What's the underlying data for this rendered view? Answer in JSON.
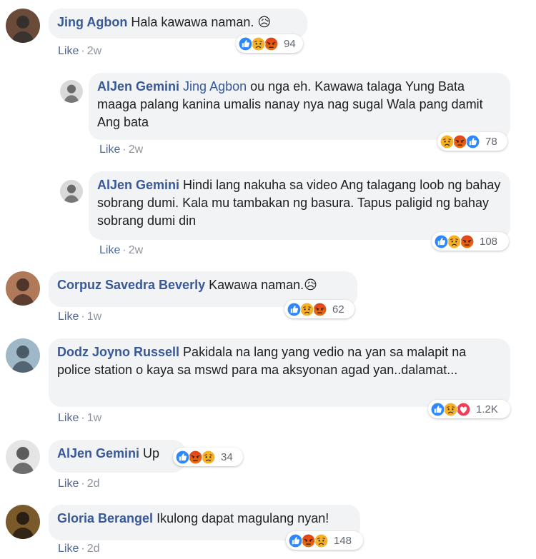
{
  "comments": [
    {
      "author": "Jing Agbon",
      "mention": "",
      "text": "Hala kawawa naman. 😥",
      "like": "Like",
      "time": "2w",
      "reactions": [
        "like-icon",
        "sad-icon",
        "angry-icon"
      ],
      "count": "94",
      "avatar_colors": [
        "#6a4b3a",
        "#2b2b2b"
      ]
    },
    {
      "author": "AlJen Gemini",
      "mention": "Jing Agbon",
      "text": "ou nga eh. Kawawa talaga Yung Bata maaga palang kanina umalis nanay nya nag sugal Wala pang damit Ang bata",
      "like": "Like",
      "time": "2w",
      "reactions": [
        "sad-icon",
        "angry-icon",
        "like-icon"
      ],
      "count": "78",
      "avatar_colors": [
        "#d9d9d9",
        "#555555"
      ]
    },
    {
      "author": "AlJen Gemini",
      "mention": "",
      "text": "Hindi lang nakuha sa video Ang talagang loob ng bahay sobrang dumi. Kala mu tambakan ng basura. Tapus paligid ng bahay sobrang dumi din",
      "like": "Like",
      "time": "2w",
      "reactions": [
        "like-icon",
        "sad-icon",
        "angry-icon"
      ],
      "count": "108",
      "avatar_colors": [
        "#d9d9d9",
        "#555555"
      ]
    },
    {
      "author": "Corpuz Savedra Beverly",
      "mention": "",
      "text": "Kawawa naman.😥",
      "like": "Like",
      "time": "1w",
      "reactions": [
        "like-icon",
        "sad-icon",
        "angry-icon"
      ],
      "count": "62",
      "avatar_colors": [
        "#b07a5a",
        "#3d2a22"
      ]
    },
    {
      "author": "Dodz Joyno Russell",
      "mention": "",
      "text": "Pakidala na lang yang vedio na yan sa malapit na police station o kaya sa mswd para ma aksyonan agad yan..dalamat...",
      "like": "Like",
      "time": "1w",
      "reactions": [
        "like-icon",
        "sad-icon",
        "love-icon"
      ],
      "count": "1.2K",
      "avatar_colors": [
        "#9fb8c8",
        "#3a4a55"
      ]
    },
    {
      "author": "AlJen Gemini",
      "mention": "",
      "text": "Up",
      "like": "Like",
      "time": "2d",
      "reactions": [
        "like-icon",
        "angry-icon",
        "sad-icon"
      ],
      "count": "34",
      "avatar_colors": [
        "#e5e5e5",
        "#444444"
      ]
    },
    {
      "author": "Gloria Berangel",
      "mention": "",
      "text": "Ikulong dapat magulang nyan!",
      "like": "Like",
      "time": "2d",
      "reactions": [
        "like-icon",
        "angry-icon",
        "sad-icon"
      ],
      "count": "148",
      "avatar_colors": [
        "#7a5a2a",
        "#1c1410"
      ]
    }
  ],
  "colors": {
    "like": "#2d88ff",
    "sad": "#f7b125",
    "angry": "#e9710f",
    "love": "#f33e58",
    "link": "#385898",
    "bubble": "#f2f3f5"
  }
}
